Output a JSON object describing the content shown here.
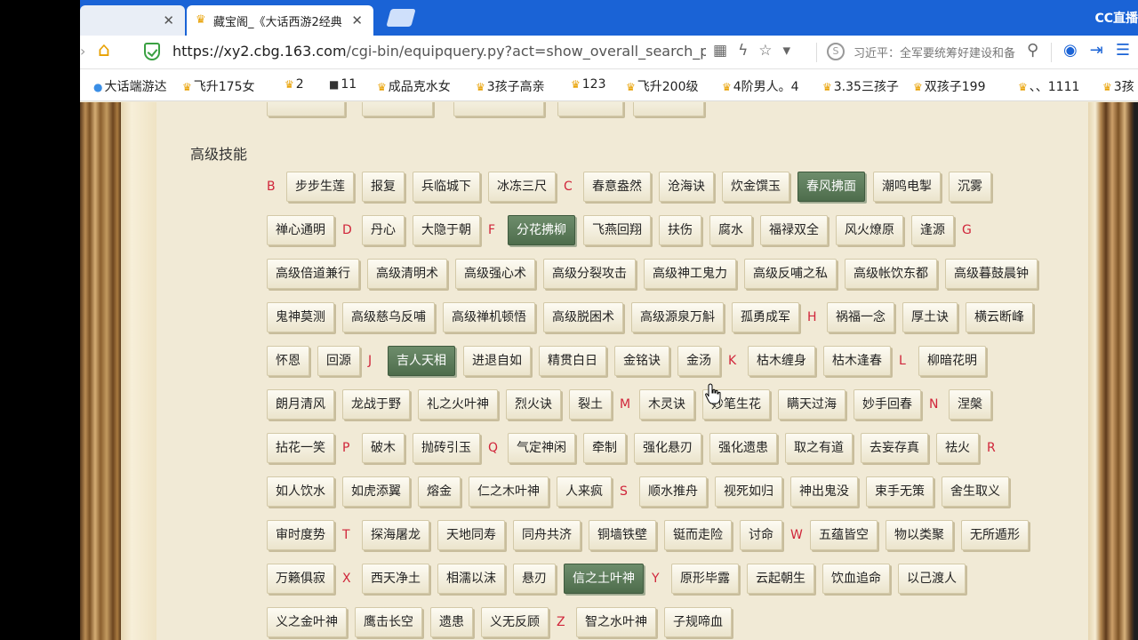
{
  "browser": {
    "tabs": [
      {
        "label": "",
        "close": "✕"
      },
      {
        "label": "藏宝阁_《大话西游2经典",
        "close": "✕"
      }
    ],
    "cc_logo": "CC直播",
    "url_host": "https://xy2.cbg.163.com",
    "url_path": "/cgi-bin/equipquery.py?act=show_overall_search_pet",
    "news_text": "习近平：全军要统筹好建设和备",
    "bookmarks": [
      "大话端游达",
      "飞升175女",
      "2",
      "11",
      "成品克水女",
      "3孩子高亲",
      "123",
      "飞升200级",
      "4阶男人。4",
      "3.35三孩子",
      "双孩子199",
      "、、1111",
      "3孩"
    ]
  },
  "page": {
    "top_partial": [
      "",
      "",
      "",
      "",
      ""
    ],
    "section_title": "高级技能",
    "rows": [
      [
        [
          "L",
          "B"
        ],
        [
          "S",
          "步步生莲"
        ],
        [
          "S",
          "报复"
        ],
        [
          "S",
          "兵临城下"
        ],
        [
          "S",
          "冰冻三尺"
        ],
        [
          "L",
          "C"
        ],
        [
          "S",
          "春意盎然"
        ],
        [
          "S",
          "沧海诀"
        ],
        [
          "S",
          "炊金馔玉"
        ],
        [
          "A",
          "春风拂面"
        ],
        [
          "S",
          "潮鸣电掣"
        ],
        [
          "S",
          "沉雾"
        ]
      ],
      [
        [
          "S",
          "禅心通明"
        ],
        [
          "L",
          "D"
        ],
        [
          "S",
          "丹心"
        ],
        [
          "S",
          "大隐于朝"
        ],
        [
          "L",
          "F"
        ],
        [
          "A",
          "分花拂柳"
        ],
        [
          "S",
          "飞燕回翔"
        ],
        [
          "S",
          "扶伤"
        ],
        [
          "S",
          "腐水"
        ],
        [
          "S",
          "福禄双全"
        ],
        [
          "S",
          "风火燎原"
        ],
        [
          "S",
          "逢源"
        ],
        [
          "L",
          "G"
        ]
      ],
      [
        [
          "S",
          "高级倍道兼行"
        ],
        [
          "S",
          "高级清明术"
        ],
        [
          "S",
          "高级强心术"
        ],
        [
          "S",
          "高级分裂攻击"
        ],
        [
          "S",
          "高级神工鬼力"
        ],
        [
          "S",
          "高级反哺之私"
        ],
        [
          "S",
          "高级帐饮东都"
        ],
        [
          "S",
          "高级暮鼓晨钟"
        ]
      ],
      [
        [
          "S",
          "鬼神莫测"
        ],
        [
          "S",
          "高级慈乌反哺"
        ],
        [
          "S",
          "高级禅机顿悟"
        ],
        [
          "S",
          "高级脱困术"
        ],
        [
          "S",
          "高级源泉万斛"
        ],
        [
          "S",
          "孤勇成军"
        ],
        [
          "L",
          "H"
        ],
        [
          "S",
          "祸福一念"
        ],
        [
          "S",
          "厚土诀"
        ],
        [
          "S",
          "横云断峰"
        ]
      ],
      [
        [
          "S",
          "怀恩"
        ],
        [
          "S",
          "回源"
        ],
        [
          "L",
          "J"
        ],
        [
          "A",
          "吉人天相"
        ],
        [
          "S",
          "进退自如"
        ],
        [
          "S",
          "精贯白日"
        ],
        [
          "S",
          "金铭诀"
        ],
        [
          "S",
          "金汤"
        ],
        [
          "L",
          "K"
        ],
        [
          "S",
          "枯木缠身"
        ],
        [
          "S",
          "枯木逢春"
        ],
        [
          "L",
          "L"
        ],
        [
          "S",
          "柳暗花明"
        ]
      ],
      [
        [
          "S",
          "朗月清风"
        ],
        [
          "S",
          "龙战于野"
        ],
        [
          "S",
          "礼之火叶神"
        ],
        [
          "S",
          "烈火诀"
        ],
        [
          "S",
          "裂土"
        ],
        [
          "L",
          "M"
        ],
        [
          "S",
          "木灵诀"
        ],
        [
          "S",
          "妙笔生花"
        ],
        [
          "S",
          "瞒天过海"
        ],
        [
          "S",
          "妙手回春"
        ],
        [
          "L",
          "N"
        ],
        [
          "S",
          "涅槃"
        ]
      ],
      [
        [
          "S",
          "拈花一笑"
        ],
        [
          "L",
          "P"
        ],
        [
          "S",
          "破木"
        ],
        [
          "S",
          "抛砖引玉"
        ],
        [
          "L",
          "Q"
        ],
        [
          "S",
          "气定神闲"
        ],
        [
          "S",
          "牵制"
        ],
        [
          "S",
          "强化悬刃"
        ],
        [
          "S",
          "强化遗患"
        ],
        [
          "S",
          "取之有道"
        ],
        [
          "S",
          "去妄存真"
        ],
        [
          "S",
          "祛火"
        ],
        [
          "L",
          "R"
        ]
      ],
      [
        [
          "S",
          "如人饮水"
        ],
        [
          "S",
          "如虎添翼"
        ],
        [
          "S",
          "熔金"
        ],
        [
          "S",
          "仁之木叶神"
        ],
        [
          "S",
          "人来疯"
        ],
        [
          "L",
          "S"
        ],
        [
          "S",
          "顺水推舟"
        ],
        [
          "S",
          "视死如归"
        ],
        [
          "S",
          "神出鬼没"
        ],
        [
          "S",
          "束手无策"
        ],
        [
          "S",
          "舍生取义"
        ]
      ],
      [
        [
          "S",
          "审时度势"
        ],
        [
          "L",
          "T"
        ],
        [
          "S",
          "探海屠龙"
        ],
        [
          "S",
          "天地同寿"
        ],
        [
          "S",
          "同舟共济"
        ],
        [
          "S",
          "铜墙铁壁"
        ],
        [
          "S",
          "铤而走险"
        ],
        [
          "S",
          "讨命"
        ],
        [
          "L",
          "W"
        ],
        [
          "S",
          "五蕴皆空"
        ],
        [
          "S",
          "物以类聚"
        ],
        [
          "S",
          "无所遁形"
        ]
      ],
      [
        [
          "S",
          "万籁俱寂"
        ],
        [
          "L",
          "X"
        ],
        [
          "S",
          "西天净土"
        ],
        [
          "S",
          "相濡以沫"
        ],
        [
          "S",
          "悬刃"
        ],
        [
          "A",
          "信之土叶神"
        ],
        [
          "L",
          "Y"
        ],
        [
          "S",
          "原形毕露"
        ],
        [
          "S",
          "云起朝生"
        ],
        [
          "S",
          "饮血追命"
        ],
        [
          "S",
          "以己渡人"
        ]
      ],
      [
        [
          "S",
          "义之金叶神"
        ],
        [
          "S",
          "鹰击长空"
        ],
        [
          "S",
          "遗患"
        ],
        [
          "S",
          "义无反顾"
        ],
        [
          "L",
          "Z"
        ],
        [
          "S",
          "智之水叶神"
        ],
        [
          "S",
          "子规啼血"
        ]
      ]
    ]
  }
}
